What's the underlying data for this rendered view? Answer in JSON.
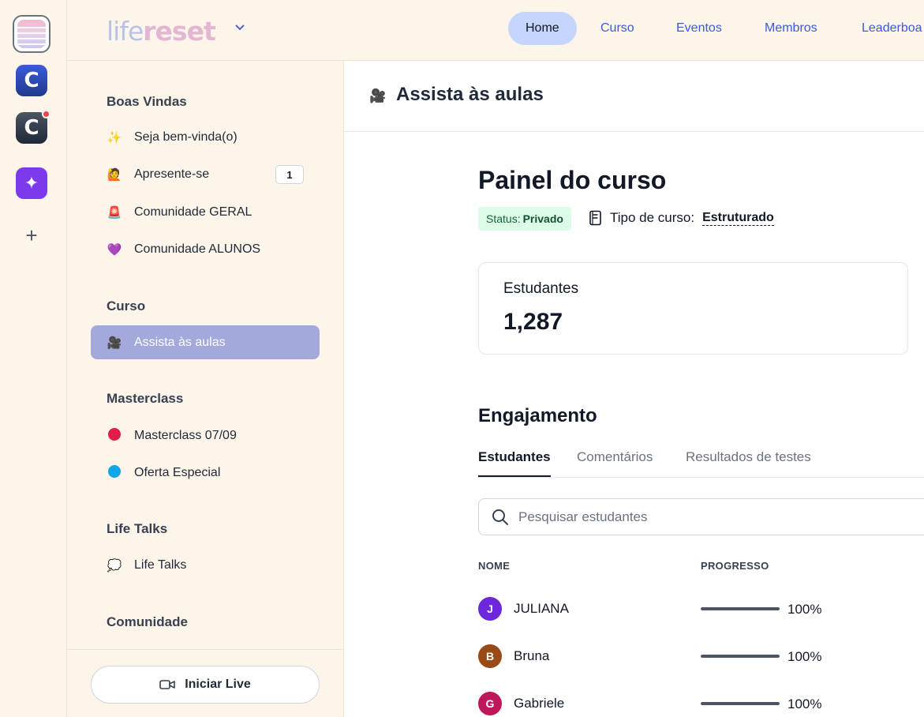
{
  "rail": {
    "communities": [
      {
        "name": "lifereset-community-icon"
      },
      {
        "letter": "C",
        "color": "#2f4bc7"
      },
      {
        "letter": "C",
        "color": "#374151",
        "has_notification": true
      }
    ],
    "ai_icon": "sparkle-icon",
    "add_label": "+"
  },
  "header": {
    "logo_part1": "life",
    "logo_part2": "reset",
    "nav": [
      {
        "label": "Home",
        "active": true
      },
      {
        "label": "Curso"
      },
      {
        "label": "Eventos"
      },
      {
        "label": "Membros"
      },
      {
        "label": "Leaderboa"
      }
    ]
  },
  "sidebar": {
    "sections": [
      {
        "title": "Boas Vindas",
        "items": [
          {
            "emoji": "✨",
            "label": "Seja bem-vinda(o)"
          },
          {
            "emoji": "🙋",
            "label": "Apresente-se",
            "badge": "1"
          },
          {
            "emoji": "🚨",
            "label": "Comunidade GERAL"
          },
          {
            "emoji": "💜",
            "label": "Comunidade ALUNOS"
          }
        ]
      },
      {
        "title": "Curso",
        "items": [
          {
            "emoji": "🎥",
            "label": "Assista às aulas",
            "active": true
          }
        ]
      },
      {
        "title": "Masterclass",
        "items": [
          {
            "dot_color": "#e11d48",
            "label": "Masterclass 07/09"
          },
          {
            "dot_color": "#0ea5e9",
            "label": "Oferta Especial"
          }
        ]
      },
      {
        "title": "Life Talks",
        "items": [
          {
            "emoji": "💭",
            "label": "Life Talks"
          }
        ]
      },
      {
        "title": "Comunidade",
        "items": []
      }
    ],
    "live_button": "Iniciar Live"
  },
  "main": {
    "header_emoji": "🎥",
    "header_title": "Assista às aulas",
    "page_title": "Painel do curso",
    "status_label": "Status:",
    "status_value": "Privado",
    "course_type_label": "Tipo de curso:",
    "course_type_value": "Estruturado",
    "stat": {
      "label": "Estudantes",
      "value": "1,287"
    },
    "engagement_title": "Engajamento",
    "tabs": [
      "Estudantes",
      "Comentários",
      "Resultados de testes"
    ],
    "active_tab": 0,
    "search_placeholder": "Pesquisar estudantes",
    "columns": {
      "name": "NOME",
      "progress": "PROGRESSO"
    },
    "students": [
      {
        "initial": "J",
        "name": "JULIANA",
        "avatar_color": "#6d28d9",
        "progress": 1.0,
        "progress_label": "100%"
      },
      {
        "initial": "B",
        "name": "Bruna",
        "avatar_color": "#9a4a17",
        "progress": 1.0,
        "progress_label": "100%"
      },
      {
        "initial": "G",
        "name": "Gabriele",
        "avatar_color": "#be185d",
        "progress": 1.0,
        "progress_label": "100%"
      }
    ]
  }
}
